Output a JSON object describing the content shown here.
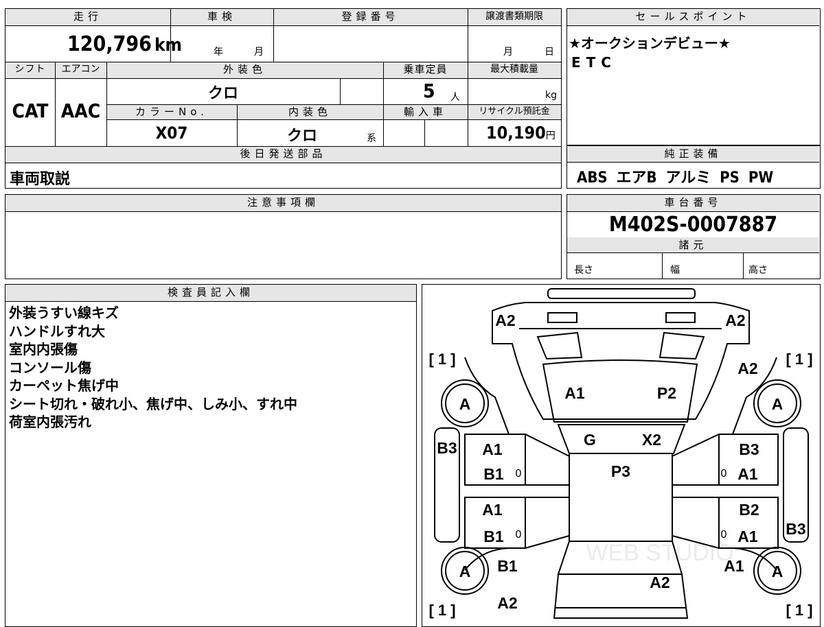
{
  "headers": {
    "mileage": "走行",
    "inspection": "車検",
    "registration": "登録番号",
    "transfer_deadline": "譲渡書類期限",
    "sales_point": "セールスポイント",
    "shift": "シフト",
    "aircon": "エアコン",
    "exterior_color": "外装色",
    "capacity": "乗車定員",
    "max_load": "最大積載量",
    "color_no": "カラーNo.",
    "interior_color": "内装色",
    "imported": "輸入車",
    "recycle_fee": "リサイクル預託金",
    "later_parts": "後日発送部品",
    "genuine_equipment": "純正装備",
    "notes": "注意事項欄",
    "chassis_no": "車台番号",
    "specs": "諸元",
    "inspector": "検査員記入欄"
  },
  "values": {
    "mileage": "120,796",
    "mileage_unit": "km",
    "year_label": "年",
    "month_label": "月",
    "day_label": "日",
    "shift": "CAT",
    "aircon": "AAC",
    "exterior_color": "クロ",
    "capacity": "5",
    "capacity_unit": "人",
    "max_load_unit": "kg",
    "color_no": "X07",
    "interior_color": "クロ",
    "interior_suffix": "系",
    "recycle_fee": "10,190",
    "recycle_unit": "円",
    "later_parts": "車両取説",
    "chassis_no": "M402S-0007887",
    "length_label": "長さ",
    "width_label": "幅",
    "height_label": "高さ"
  },
  "sales_point": [
    "★オークションデビュー★",
    "ETC"
  ],
  "equipment": "ABS エアB アルミ PS PW",
  "inspector_notes": [
    "外装うすい線キズ",
    "ハンドルすれ大",
    "室内内張傷",
    "コンソール傷",
    "カーペット焦げ中",
    "シート切れ・破れ小、焦げ中、しみ小、すれ中",
    "荷室内張汚れ"
  ],
  "diagram": {
    "front_left": "A2",
    "front_right": "A2",
    "hood_left": "A1",
    "hood_right": "P2",
    "windshield_left": "G",
    "windshield_right": "X2",
    "roof": "P3",
    "fender_right_front": "A2",
    "left_sill": "B3",
    "left_front_door_1": "A1",
    "left_front_door_2": "B1",
    "left_rear_door_1": "A1",
    "left_rear_door_2": "B1",
    "right_front_door_1": "B3",
    "right_front_door_2": "A1",
    "right_rear_door_1": "B2",
    "right_rear_door_2": "A1",
    "right_sill": "B3",
    "rear_left_fender": "B1",
    "rear_right_fender": "A1",
    "rear_left": "A2",
    "rear_center": "A2",
    "wheel": "A",
    "tire_mark": "[ 1 ]",
    "zero_mark": "0",
    "watermark": "WEB STUDIO"
  }
}
